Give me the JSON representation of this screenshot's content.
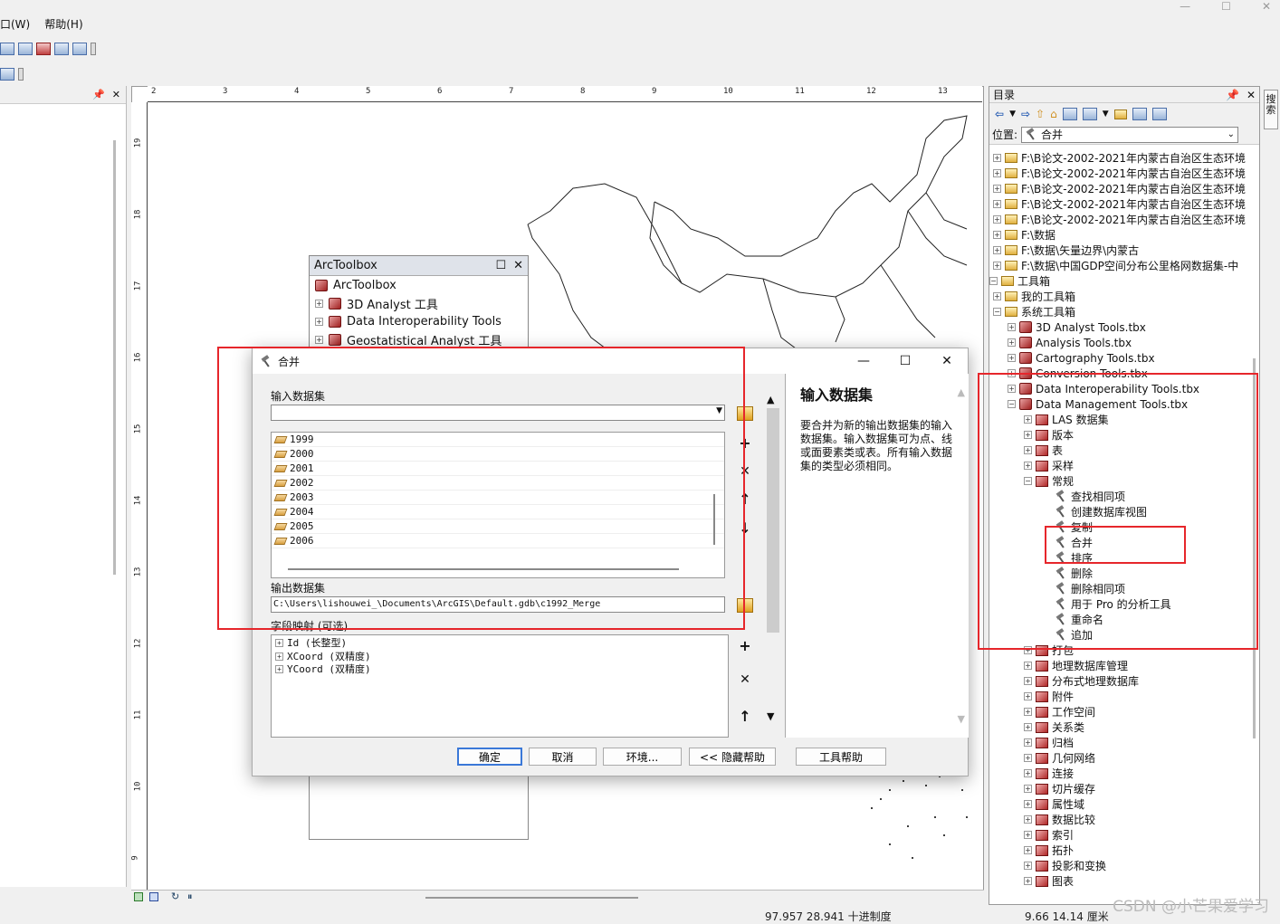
{
  "menubar": {
    "window": "口(W)",
    "help": "帮助(H)"
  },
  "status": {
    "coords": "97.957  28.941 十进制度",
    "page_coords": "9.66  14.14 厘米"
  },
  "ruler": {
    "top": [
      "2",
      "3",
      "4",
      "5",
      "6",
      "7",
      "8",
      "9",
      "10",
      "11",
      "12",
      "13"
    ],
    "left": [
      "19",
      "18",
      "17",
      "16",
      "15",
      "14",
      "13",
      "12",
      "11",
      "10",
      "9"
    ]
  },
  "arctoolbox": {
    "title": "ArcToolbox",
    "root": "ArcToolbox",
    "items": [
      "3D Analyst 工具",
      "Data Interoperability Tools",
      "Geostatistical Analyst 工具"
    ]
  },
  "merge": {
    "title": "合并",
    "input_label": "输入数据集",
    "input_value": "",
    "datasets": [
      "1999",
      "2000",
      "2001",
      "2002",
      "2003",
      "2004",
      "2005",
      "2006"
    ],
    "output_label": "输出数据集",
    "output_value": "C:\\Users\\lishouwei_\\Documents\\ArcGIS\\Default.gdb\\c1992_Merge",
    "field_map_label": "字段映射 (可选)",
    "fields": [
      "Id (长整型)",
      "XCoord (双精度)",
      "YCoord (双精度)"
    ],
    "help_title": "输入数据集",
    "help_text": "要合并为新的输出数据集的输入数据集。输入数据集可为点、线或面要素类或表。所有输入数据集的类型必须相同。",
    "buttons": {
      "ok": "确定",
      "cancel": "取消",
      "env": "环境...",
      "hide_help": "<< 隐藏帮助",
      "tool_help": "工具帮助"
    }
  },
  "catalog": {
    "title": "目录",
    "location_label": "位置:",
    "location_value": "合并",
    "tree": [
      {
        "t": "F:\\B论文-2002-2021年内蒙古自治区生态环境",
        "k": "folder",
        "l": 0
      },
      {
        "t": "F:\\B论文-2002-2021年内蒙古自治区生态环境",
        "k": "folder",
        "l": 0
      },
      {
        "t": "F:\\B论文-2002-2021年内蒙古自治区生态环境",
        "k": "folder",
        "l": 0
      },
      {
        "t": "F:\\B论文-2002-2021年内蒙古自治区生态环境",
        "k": "folder",
        "l": 0
      },
      {
        "t": "F:\\B论文-2002-2021年内蒙古自治区生态环境",
        "k": "folder",
        "l": 0
      },
      {
        "t": "F:\\数据",
        "k": "folder",
        "l": 0
      },
      {
        "t": "F:\\数据\\矢量边界\\内蒙古",
        "k": "folder",
        "l": 0
      },
      {
        "t": "F:\\数据\\中国GDP空间分布公里格网数据集-中",
        "k": "folder",
        "l": 0
      },
      {
        "t": "工具箱",
        "k": "folder",
        "l": -1
      },
      {
        "t": "我的工具箱",
        "k": "folder",
        "l": 0
      },
      {
        "t": "系统工具箱",
        "k": "folder",
        "l": 0
      },
      {
        "t": "3D Analyst Tools.tbx",
        "k": "tbx",
        "l": 1
      },
      {
        "t": "Analysis Tools.tbx",
        "k": "tbx",
        "l": 1
      },
      {
        "t": "Cartography Tools.tbx",
        "k": "tbx",
        "l": 1
      },
      {
        "t": "Conversion Tools.tbx",
        "k": "tbx",
        "l": 1
      },
      {
        "t": "Data Interoperability Tools.tbx",
        "k": "tbx",
        "l": 1
      },
      {
        "t": "Data Management Tools.tbx",
        "k": "tbx",
        "l": 1
      },
      {
        "t": "LAS 数据集",
        "k": "set",
        "l": 2
      },
      {
        "t": "版本",
        "k": "set",
        "l": 2
      },
      {
        "t": "表",
        "k": "set",
        "l": 2
      },
      {
        "t": "采样",
        "k": "set",
        "l": 2
      },
      {
        "t": "常规",
        "k": "set",
        "l": 2
      },
      {
        "t": "查找相同项",
        "k": "tool",
        "l": 3
      },
      {
        "t": "创建数据库视图",
        "k": "tool",
        "l": 3
      },
      {
        "t": "复制",
        "k": "tool",
        "l": 3
      },
      {
        "t": "合并",
        "k": "tool",
        "l": 3
      },
      {
        "t": "排序",
        "k": "tool",
        "l": 3
      },
      {
        "t": "删除",
        "k": "tool",
        "l": 3
      },
      {
        "t": "删除相同项",
        "k": "tool",
        "l": 3
      },
      {
        "t": "用于 Pro 的分析工具",
        "k": "tool",
        "l": 3
      },
      {
        "t": "重命名",
        "k": "tool",
        "l": 3
      },
      {
        "t": "追加",
        "k": "tool",
        "l": 3
      },
      {
        "t": "打包",
        "k": "set",
        "l": 2
      },
      {
        "t": "地理数据库管理",
        "k": "set",
        "l": 2
      },
      {
        "t": "分布式地理数据库",
        "k": "set",
        "l": 2
      },
      {
        "t": "附件",
        "k": "set",
        "l": 2
      },
      {
        "t": "工作空间",
        "k": "set",
        "l": 2
      },
      {
        "t": "关系类",
        "k": "set",
        "l": 2
      },
      {
        "t": "归档",
        "k": "set",
        "l": 2
      },
      {
        "t": "几何网络",
        "k": "set",
        "l": 2
      },
      {
        "t": "连接",
        "k": "set",
        "l": 2
      },
      {
        "t": "切片缓存",
        "k": "set",
        "l": 2
      },
      {
        "t": "属性域",
        "k": "set",
        "l": 2
      },
      {
        "t": "数据比较",
        "k": "set",
        "l": 2
      },
      {
        "t": "索引",
        "k": "set",
        "l": 2
      },
      {
        "t": "拓扑",
        "k": "set",
        "l": 2
      },
      {
        "t": "投影和变换",
        "k": "set",
        "l": 2
      },
      {
        "t": "图表",
        "k": "set",
        "l": 2
      }
    ]
  },
  "side_tab": "搜索",
  "watermark": "CSDN @小芒果爱学习"
}
